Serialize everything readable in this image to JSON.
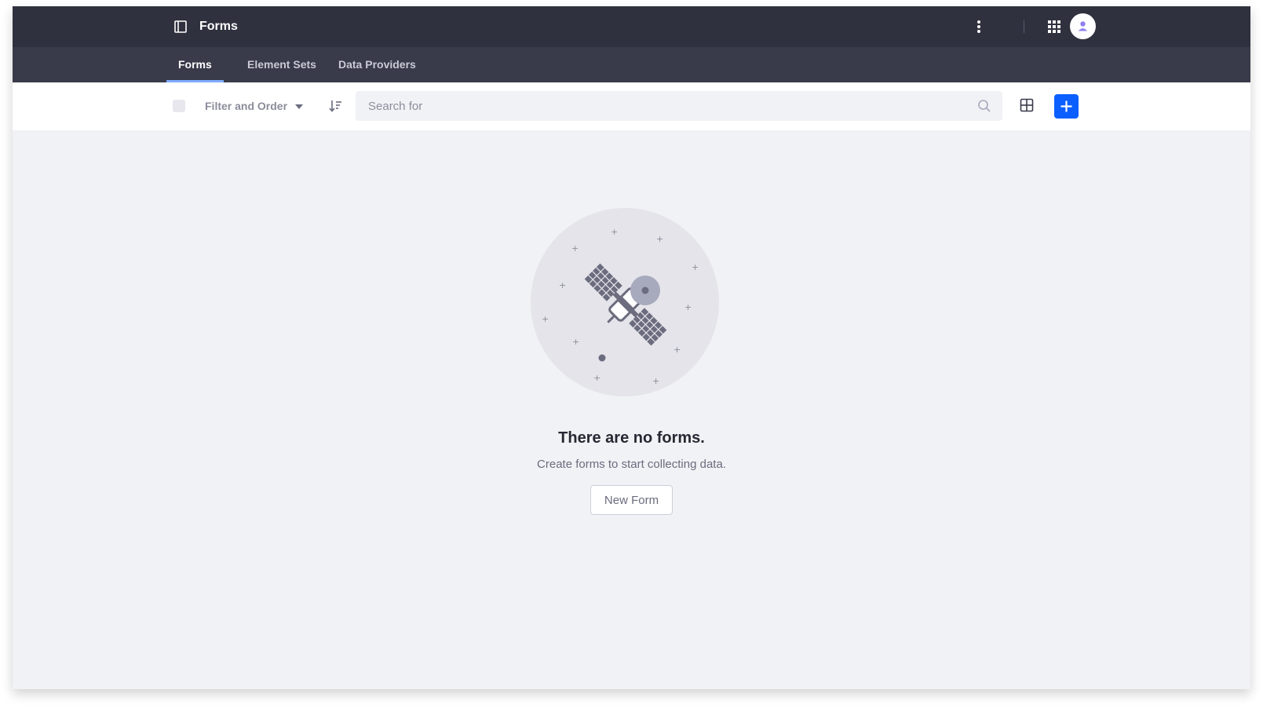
{
  "header": {
    "title": "Forms"
  },
  "tabs": [
    {
      "label": "Forms",
      "active": true
    },
    {
      "label": "Element Sets",
      "active": false
    },
    {
      "label": "Data Providers",
      "active": false
    }
  ],
  "toolbar": {
    "filter_label": "Filter and Order",
    "search": {
      "placeholder": "Search for",
      "value": ""
    }
  },
  "empty_state": {
    "title": "There are no forms.",
    "description": "Create forms to start collecting data.",
    "button_label": "New Form"
  },
  "icons": {
    "panel_toggle": "sidebar-panel-icon",
    "kebab": "more-vertical-icon",
    "apps": "apps-grid-icon",
    "avatar": "user-icon",
    "sort": "sort-order-icon",
    "search": "search-icon",
    "cards": "cards-view-icon",
    "add": "plus-icon",
    "caret": "caret-down-icon"
  },
  "colors": {
    "topbar": "#30313f",
    "tabsbar": "#393a4a",
    "active_tab_indicator": "#80acff",
    "primary": "#0b5fff",
    "background": "#f1f2f5",
    "avatar_accent": "#8f7ff0"
  }
}
